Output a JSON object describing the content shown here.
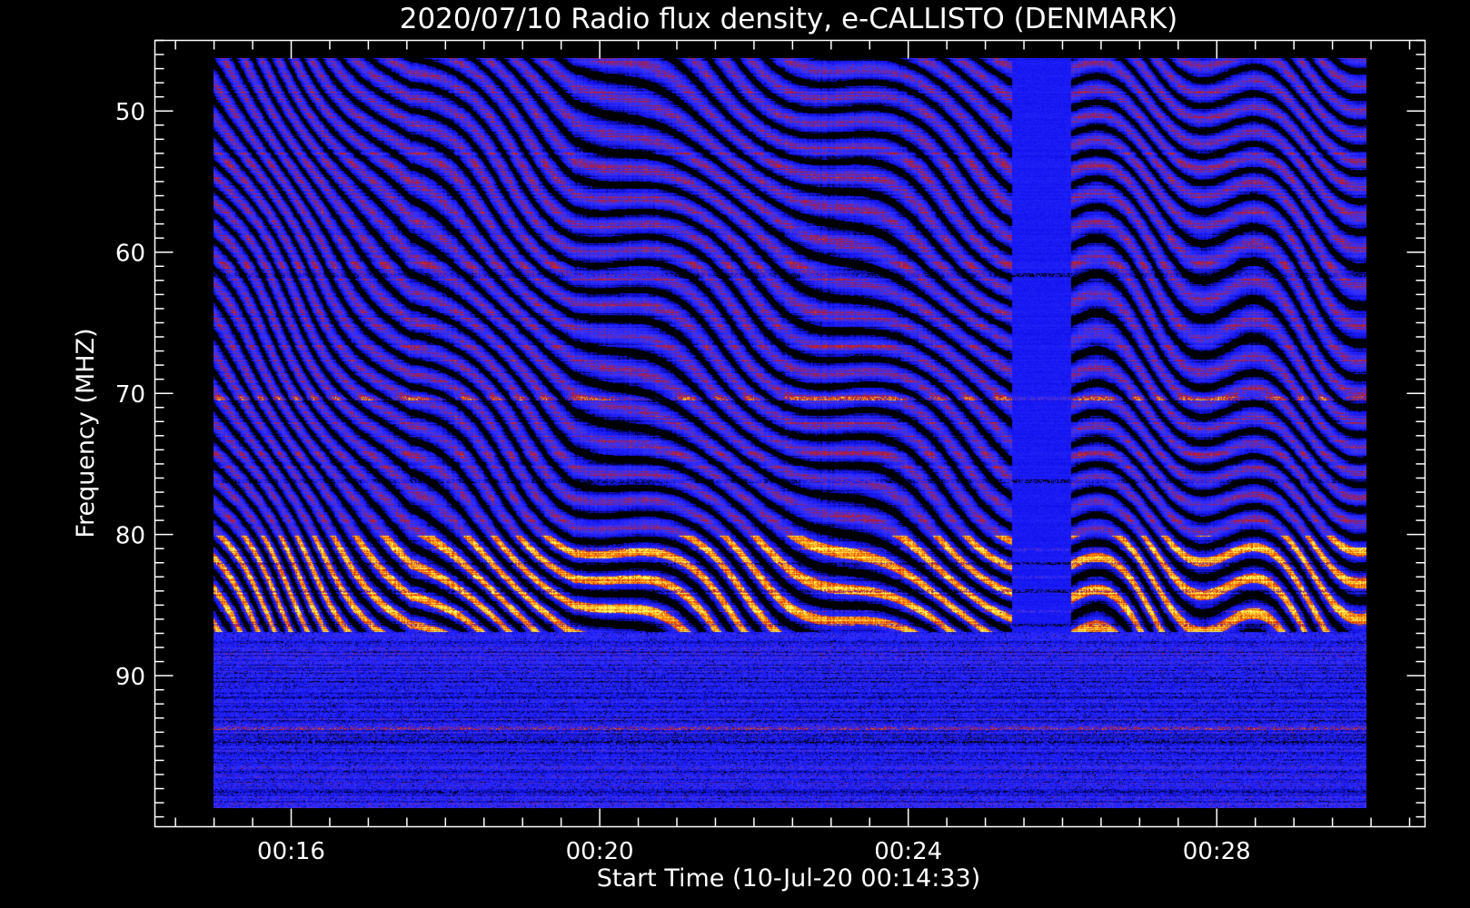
{
  "chart_data": {
    "type": "heatmap",
    "title": "2020/07/10  Radio flux density, e-CALLISTO (DENMARK)",
    "xlabel": "Start Time (10-Jul-20 00:14:33)",
    "ylabel": "Frequency (MHZ)",
    "x_tick_labels": [
      "00:16",
      "00:20",
      "00:24",
      "00:28"
    ],
    "x_ticks_minutes": [
      16,
      20,
      24,
      28
    ],
    "y_tick_labels": [
      "50",
      "60",
      "70",
      "80",
      "90"
    ],
    "y_ticks": [
      50,
      60,
      70,
      80,
      90
    ],
    "xlim_minutes": [
      14.233,
      30.7
    ],
    "ylim_mhz": [
      45,
      100.7
    ],
    "y_inverted": true,
    "data_time_range_minutes": [
      14.55,
      29.93
    ],
    "data_freq_range_mhz": [
      45.2,
      99.8
    ],
    "colormap": [
      "#000000",
      "#1010f0",
      "#3636ff",
      "#c81414",
      "#ff8800",
      "#ffff60"
    ],
    "notable_bands_mhz": [
      61,
      70,
      76,
      81,
      82,
      83,
      84,
      85.5,
      86.5,
      94,
      95
    ],
    "quiet_interval_minutes": [
      25.2,
      26.0
    ]
  }
}
